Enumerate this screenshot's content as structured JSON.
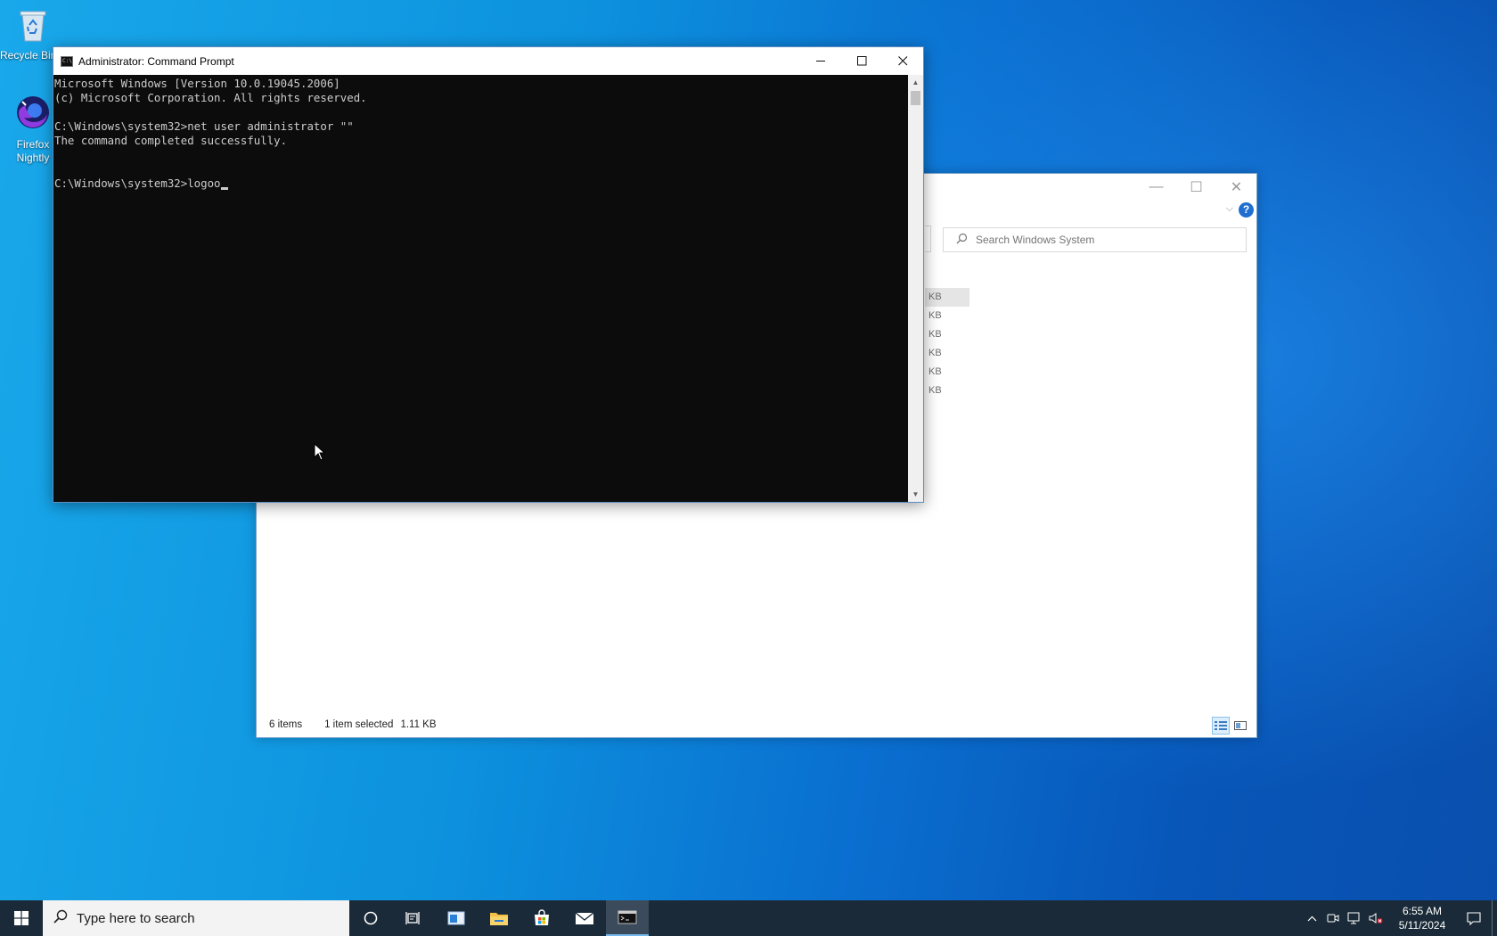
{
  "desktop": {
    "icons": [
      {
        "label": "Recycle Bin",
        "icon": "recycle-bin-icon"
      },
      {
        "label": "Firefox Nightly",
        "icon": "firefox-nightly-icon"
      }
    ]
  },
  "cmd_window": {
    "title": "Administrator: Command Prompt",
    "lines": [
      "Microsoft Windows [Version 10.0.19045.2006]",
      "(c) Microsoft Corporation. All rights reserved.",
      "",
      "C:\\Windows\\system32>net user administrator \"\"",
      "The command completed successfully.",
      "",
      "",
      "C:\\Windows\\system32>logoo"
    ]
  },
  "explorer_window": {
    "search_placeholder": "Search Windows System",
    "size_unit_cells": [
      "KB",
      "KB",
      "KB",
      "KB",
      "KB",
      "KB"
    ],
    "status": {
      "item_count": "6 items",
      "selection": "1 item selected",
      "selection_size": "1.11 KB"
    }
  },
  "taskbar": {
    "search_placeholder": "Type here to search",
    "pinned": [
      "cortana-icon",
      "task-view-icon",
      "taskbar-app-icon",
      "file-explorer-icon",
      "microsoft-store-icon",
      "mail-icon",
      "command-prompt-icon"
    ],
    "clock": {
      "time": "6:55 AM",
      "date": "5/11/2024"
    }
  },
  "colors": {
    "console_bg": "#0c0c0c",
    "console_text": "#cccccc",
    "taskbar_bg": "#1a2a38",
    "accent": "#0078d7"
  }
}
